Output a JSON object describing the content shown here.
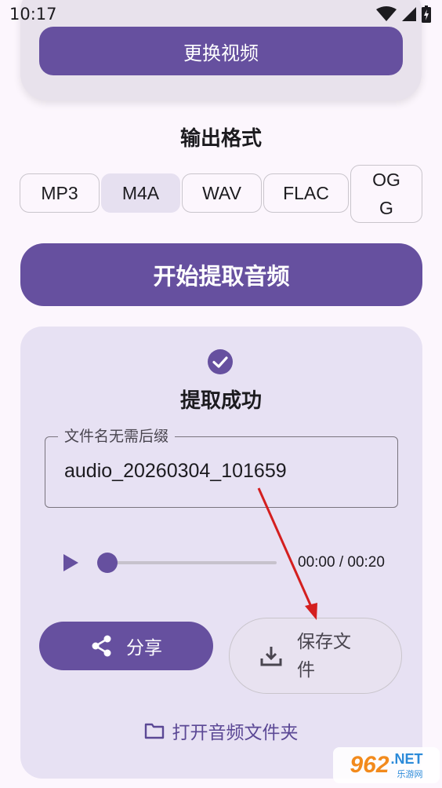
{
  "status_bar": {
    "time": "10:17"
  },
  "top": {
    "change_video_label": "更换视频"
  },
  "output": {
    "title": "输出格式",
    "formats": [
      "MP3",
      "M4A",
      "WAV",
      "FLAC",
      "OG\nG"
    ],
    "selected": "M4A"
  },
  "actions": {
    "start_label": "开始提取音频"
  },
  "result": {
    "status": "提取成功",
    "filename_label": "文件名无需后缀",
    "filename_value": "audio_20260304_101659",
    "time": "00:00 / 00:20",
    "progress_fraction": 0,
    "share_label": "分享",
    "save_label": "保存文件",
    "open_folder_label": "打开音频文件夹"
  },
  "watermark": {
    "logo_number": "962",
    "logo_domain": ".NET",
    "logo_sub": "乐游网"
  },
  "colors": {
    "primary": "#66509f",
    "card": "#e7e1f3",
    "background": "#fcf6fd",
    "annotation_arrow": "#d41f1f"
  },
  "icons": [
    "wifi-icon",
    "signal-icon",
    "battery-icon",
    "check-circle-icon",
    "play-icon",
    "share-icon",
    "download-icon",
    "folder-icon"
  ]
}
